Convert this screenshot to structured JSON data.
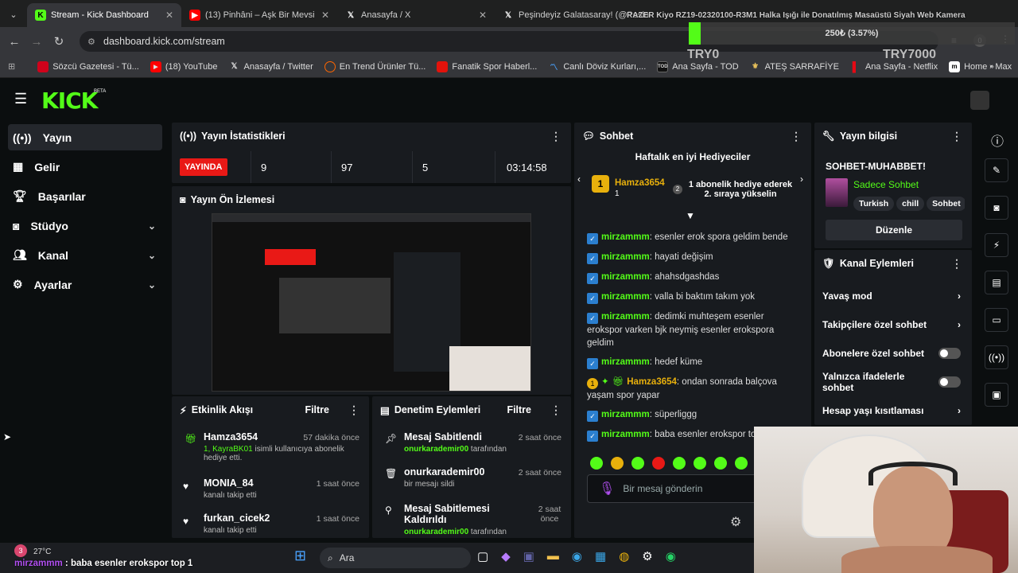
{
  "browser": {
    "tabs": [
      {
        "title": "Stream - Kick Dashboard",
        "icon": "kick-favicon"
      },
      {
        "title": "(13) Pinhâni – Aşk Bir Mevsi",
        "icon": "youtube-favicon"
      },
      {
        "title": "Anasayfa / X",
        "icon": "x-favicon"
      },
      {
        "title": "Peşindeyiz Galatasaray! (@Pesin",
        "icon": "x-favicon"
      }
    ],
    "url": "dashboard.kick.com/stream",
    "bookmarks": [
      "Sözcü Gazetesi - Tü...",
      "(18) YouTube",
      "Anasayfa / Twitter",
      "En Trend Ürünler Tü...",
      "Fanatik Spor Haberl...",
      "Canlı Döviz Kurları,...",
      "Ana Sayfa - TOD",
      "ATEŞ SARRAFİYE",
      "Ana Sayfa - Netflix",
      "Home • Max"
    ],
    "profile_badge": "0"
  },
  "overlay": {
    "ticker": "RAZER Kiyo RZ19-02320100-R3M1 Halka Işığı ile Donatılmış Masaüstü Siyah Web Kamera",
    "amount": "250₺ (3.57%)",
    "min_label": "TRY0",
    "max_label": "TRY7000",
    "progress": 0.0357
  },
  "kick": {
    "logo": "KICK",
    "beta": "BETA"
  },
  "sidebar": {
    "items": [
      {
        "label": "Yayın",
        "icon": "broadcast-icon"
      },
      {
        "label": "Gelir",
        "icon": "chart-icon"
      },
      {
        "label": "Başarılar",
        "icon": "trophy-icon"
      },
      {
        "label": "Stüdyo",
        "icon": "studio-icon"
      },
      {
        "label": "Kanal",
        "icon": "users-icon"
      },
      {
        "label": "Ayarlar",
        "icon": "gear-icon"
      }
    ]
  },
  "stats": {
    "title": "Yayın İstatistikleri",
    "live": "YAYINDA",
    "viewers": "9",
    "followers": "97",
    "subs": "5",
    "duration": "03:14:58"
  },
  "preview": {
    "title": "Yayın Ön İzlemesi"
  },
  "activity": {
    "title": "Etkinlik Akışı",
    "filter": "Filtre",
    "items": [
      {
        "user": "Hamza3654",
        "time": "57 dakika önce",
        "detail_highlight": "1, KayraBK01",
        "detail": " isimli kullanıcıya abonelik hediye etti."
      },
      {
        "user": "MONIA_84",
        "time": "1 saat önce",
        "detail_highlight": "",
        "detail": "kanalı takip etti"
      },
      {
        "user": "furkan_cicek2",
        "time": "1 saat önce",
        "detail_highlight": "",
        "detail": "kanalı takip etti"
      }
    ]
  },
  "moderation": {
    "title": "Denetim Eylemleri",
    "filter": "Filtre",
    "items": [
      {
        "action": "Mesaj Sabitlendi",
        "time": "2 saat önce",
        "by_user": "onurkarademir00",
        "by": " tarafından"
      },
      {
        "action": "onurkarademir00",
        "time": "2 saat önce",
        "by_user": "",
        "by": "bir mesajı sildi"
      },
      {
        "action": "Mesaj Sabitlemesi Kaldırıldı",
        "time": "2 saat önce",
        "by_user": "onurkarademir00",
        "by": " tarafından"
      }
    ]
  },
  "chat": {
    "title": "Sohbet",
    "gifters_title": "Haftalık en iyi Hediyeciler",
    "top_gifter": "Hamza3654",
    "top_gifter_count": "1",
    "rank_text_1": "1 abonelik hediye ederek",
    "rank_text_2": "2. sıraya yükselin",
    "messages": [
      {
        "user": "mirzammm",
        "text": ": esenler erok spora geldim bende"
      },
      {
        "user": "mirzammm",
        "text": ": hayati değişim"
      },
      {
        "user": "mirzammm",
        "text": ": ahahsdgashdas"
      },
      {
        "user": "mirzammm",
        "text": ": valla bi baktım takım yok"
      },
      {
        "user": "mirzammm",
        "text": ": dedimki muhteşem esenler erokspor varken bjk neymiş esenler erokspora geldim"
      },
      {
        "user": "mirzammm",
        "text": ": hedef küme"
      },
      {
        "user": "Hamza3654",
        "text": ": ondan sonrada balçova yaşam spor yapar"
      },
      {
        "user": "mirzammm",
        "text": ": süperliggg"
      },
      {
        "user": "mirzammm",
        "text": ": baba esenler erokspor to"
      }
    ],
    "placeholder": "Bir mesaj gönderin"
  },
  "stream_info": {
    "title": "Yayın bilgisi",
    "stream_title": "SOHBET-MUHABBET!",
    "category": "Sadece Sohbet",
    "tags": [
      "Turkish",
      "chill",
      "Sohbet"
    ],
    "edit": "Düzenle"
  },
  "channel_actions": {
    "title": "Kanal Eylemleri",
    "rows": [
      {
        "label": "Yavaş mod",
        "control": "chevron"
      },
      {
        "label": "Takipçilere özel sohbet",
        "control": "chevron"
      },
      {
        "label": "Abonelere özel sohbet",
        "control": "toggle"
      },
      {
        "label": "Yalnızca ifadelerle sohbet",
        "control": "toggle"
      },
      {
        "label": "Hesap yaşı kısıtlaması",
        "control": "chevron"
      }
    ]
  },
  "taskbar": {
    "weather": "27°C",
    "weather_badge": "3",
    "search": "Ara",
    "chat_ticker_user": "mirzammm",
    "chat_ticker_text": " : baba esenler erokspor top 1"
  }
}
